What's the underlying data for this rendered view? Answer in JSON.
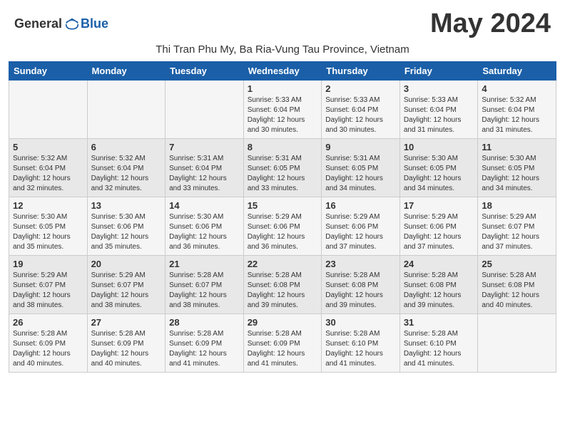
{
  "logo": {
    "general": "General",
    "blue": "Blue"
  },
  "title": "May 2024",
  "subtitle": "Thi Tran Phu My, Ba Ria-Vung Tau Province, Vietnam",
  "days_header": [
    "Sunday",
    "Monday",
    "Tuesday",
    "Wednesday",
    "Thursday",
    "Friday",
    "Saturday"
  ],
  "weeks": [
    [
      {
        "day": "",
        "info": ""
      },
      {
        "day": "",
        "info": ""
      },
      {
        "day": "",
        "info": ""
      },
      {
        "day": "1",
        "info": "Sunrise: 5:33 AM\nSunset: 6:04 PM\nDaylight: 12 hours\nand 30 minutes."
      },
      {
        "day": "2",
        "info": "Sunrise: 5:33 AM\nSunset: 6:04 PM\nDaylight: 12 hours\nand 30 minutes."
      },
      {
        "day": "3",
        "info": "Sunrise: 5:33 AM\nSunset: 6:04 PM\nDaylight: 12 hours\nand 31 minutes."
      },
      {
        "day": "4",
        "info": "Sunrise: 5:32 AM\nSunset: 6:04 PM\nDaylight: 12 hours\nand 31 minutes."
      }
    ],
    [
      {
        "day": "5",
        "info": "Sunrise: 5:32 AM\nSunset: 6:04 PM\nDaylight: 12 hours\nand 32 minutes."
      },
      {
        "day": "6",
        "info": "Sunrise: 5:32 AM\nSunset: 6:04 PM\nDaylight: 12 hours\nand 32 minutes."
      },
      {
        "day": "7",
        "info": "Sunrise: 5:31 AM\nSunset: 6:04 PM\nDaylight: 12 hours\nand 33 minutes."
      },
      {
        "day": "8",
        "info": "Sunrise: 5:31 AM\nSunset: 6:05 PM\nDaylight: 12 hours\nand 33 minutes."
      },
      {
        "day": "9",
        "info": "Sunrise: 5:31 AM\nSunset: 6:05 PM\nDaylight: 12 hours\nand 34 minutes."
      },
      {
        "day": "10",
        "info": "Sunrise: 5:30 AM\nSunset: 6:05 PM\nDaylight: 12 hours\nand 34 minutes."
      },
      {
        "day": "11",
        "info": "Sunrise: 5:30 AM\nSunset: 6:05 PM\nDaylight: 12 hours\nand 34 minutes."
      }
    ],
    [
      {
        "day": "12",
        "info": "Sunrise: 5:30 AM\nSunset: 6:05 PM\nDaylight: 12 hours\nand 35 minutes."
      },
      {
        "day": "13",
        "info": "Sunrise: 5:30 AM\nSunset: 6:06 PM\nDaylight: 12 hours\nand 35 minutes."
      },
      {
        "day": "14",
        "info": "Sunrise: 5:30 AM\nSunset: 6:06 PM\nDaylight: 12 hours\nand 36 minutes."
      },
      {
        "day": "15",
        "info": "Sunrise: 5:29 AM\nSunset: 6:06 PM\nDaylight: 12 hours\nand 36 minutes."
      },
      {
        "day": "16",
        "info": "Sunrise: 5:29 AM\nSunset: 6:06 PM\nDaylight: 12 hours\nand 37 minutes."
      },
      {
        "day": "17",
        "info": "Sunrise: 5:29 AM\nSunset: 6:06 PM\nDaylight: 12 hours\nand 37 minutes."
      },
      {
        "day": "18",
        "info": "Sunrise: 5:29 AM\nSunset: 6:07 PM\nDaylight: 12 hours\nand 37 minutes."
      }
    ],
    [
      {
        "day": "19",
        "info": "Sunrise: 5:29 AM\nSunset: 6:07 PM\nDaylight: 12 hours\nand 38 minutes."
      },
      {
        "day": "20",
        "info": "Sunrise: 5:29 AM\nSunset: 6:07 PM\nDaylight: 12 hours\nand 38 minutes."
      },
      {
        "day": "21",
        "info": "Sunrise: 5:28 AM\nSunset: 6:07 PM\nDaylight: 12 hours\nand 38 minutes."
      },
      {
        "day": "22",
        "info": "Sunrise: 5:28 AM\nSunset: 6:08 PM\nDaylight: 12 hours\nand 39 minutes."
      },
      {
        "day": "23",
        "info": "Sunrise: 5:28 AM\nSunset: 6:08 PM\nDaylight: 12 hours\nand 39 minutes."
      },
      {
        "day": "24",
        "info": "Sunrise: 5:28 AM\nSunset: 6:08 PM\nDaylight: 12 hours\nand 39 minutes."
      },
      {
        "day": "25",
        "info": "Sunrise: 5:28 AM\nSunset: 6:08 PM\nDaylight: 12 hours\nand 40 minutes."
      }
    ],
    [
      {
        "day": "26",
        "info": "Sunrise: 5:28 AM\nSunset: 6:09 PM\nDaylight: 12 hours\nand 40 minutes."
      },
      {
        "day": "27",
        "info": "Sunrise: 5:28 AM\nSunset: 6:09 PM\nDaylight: 12 hours\nand 40 minutes."
      },
      {
        "day": "28",
        "info": "Sunrise: 5:28 AM\nSunset: 6:09 PM\nDaylight: 12 hours\nand 41 minutes."
      },
      {
        "day": "29",
        "info": "Sunrise: 5:28 AM\nSunset: 6:09 PM\nDaylight: 12 hours\nand 41 minutes."
      },
      {
        "day": "30",
        "info": "Sunrise: 5:28 AM\nSunset: 6:10 PM\nDaylight: 12 hours\nand 41 minutes."
      },
      {
        "day": "31",
        "info": "Sunrise: 5:28 AM\nSunset: 6:10 PM\nDaylight: 12 hours\nand 41 minutes."
      },
      {
        "day": "",
        "info": ""
      }
    ]
  ]
}
